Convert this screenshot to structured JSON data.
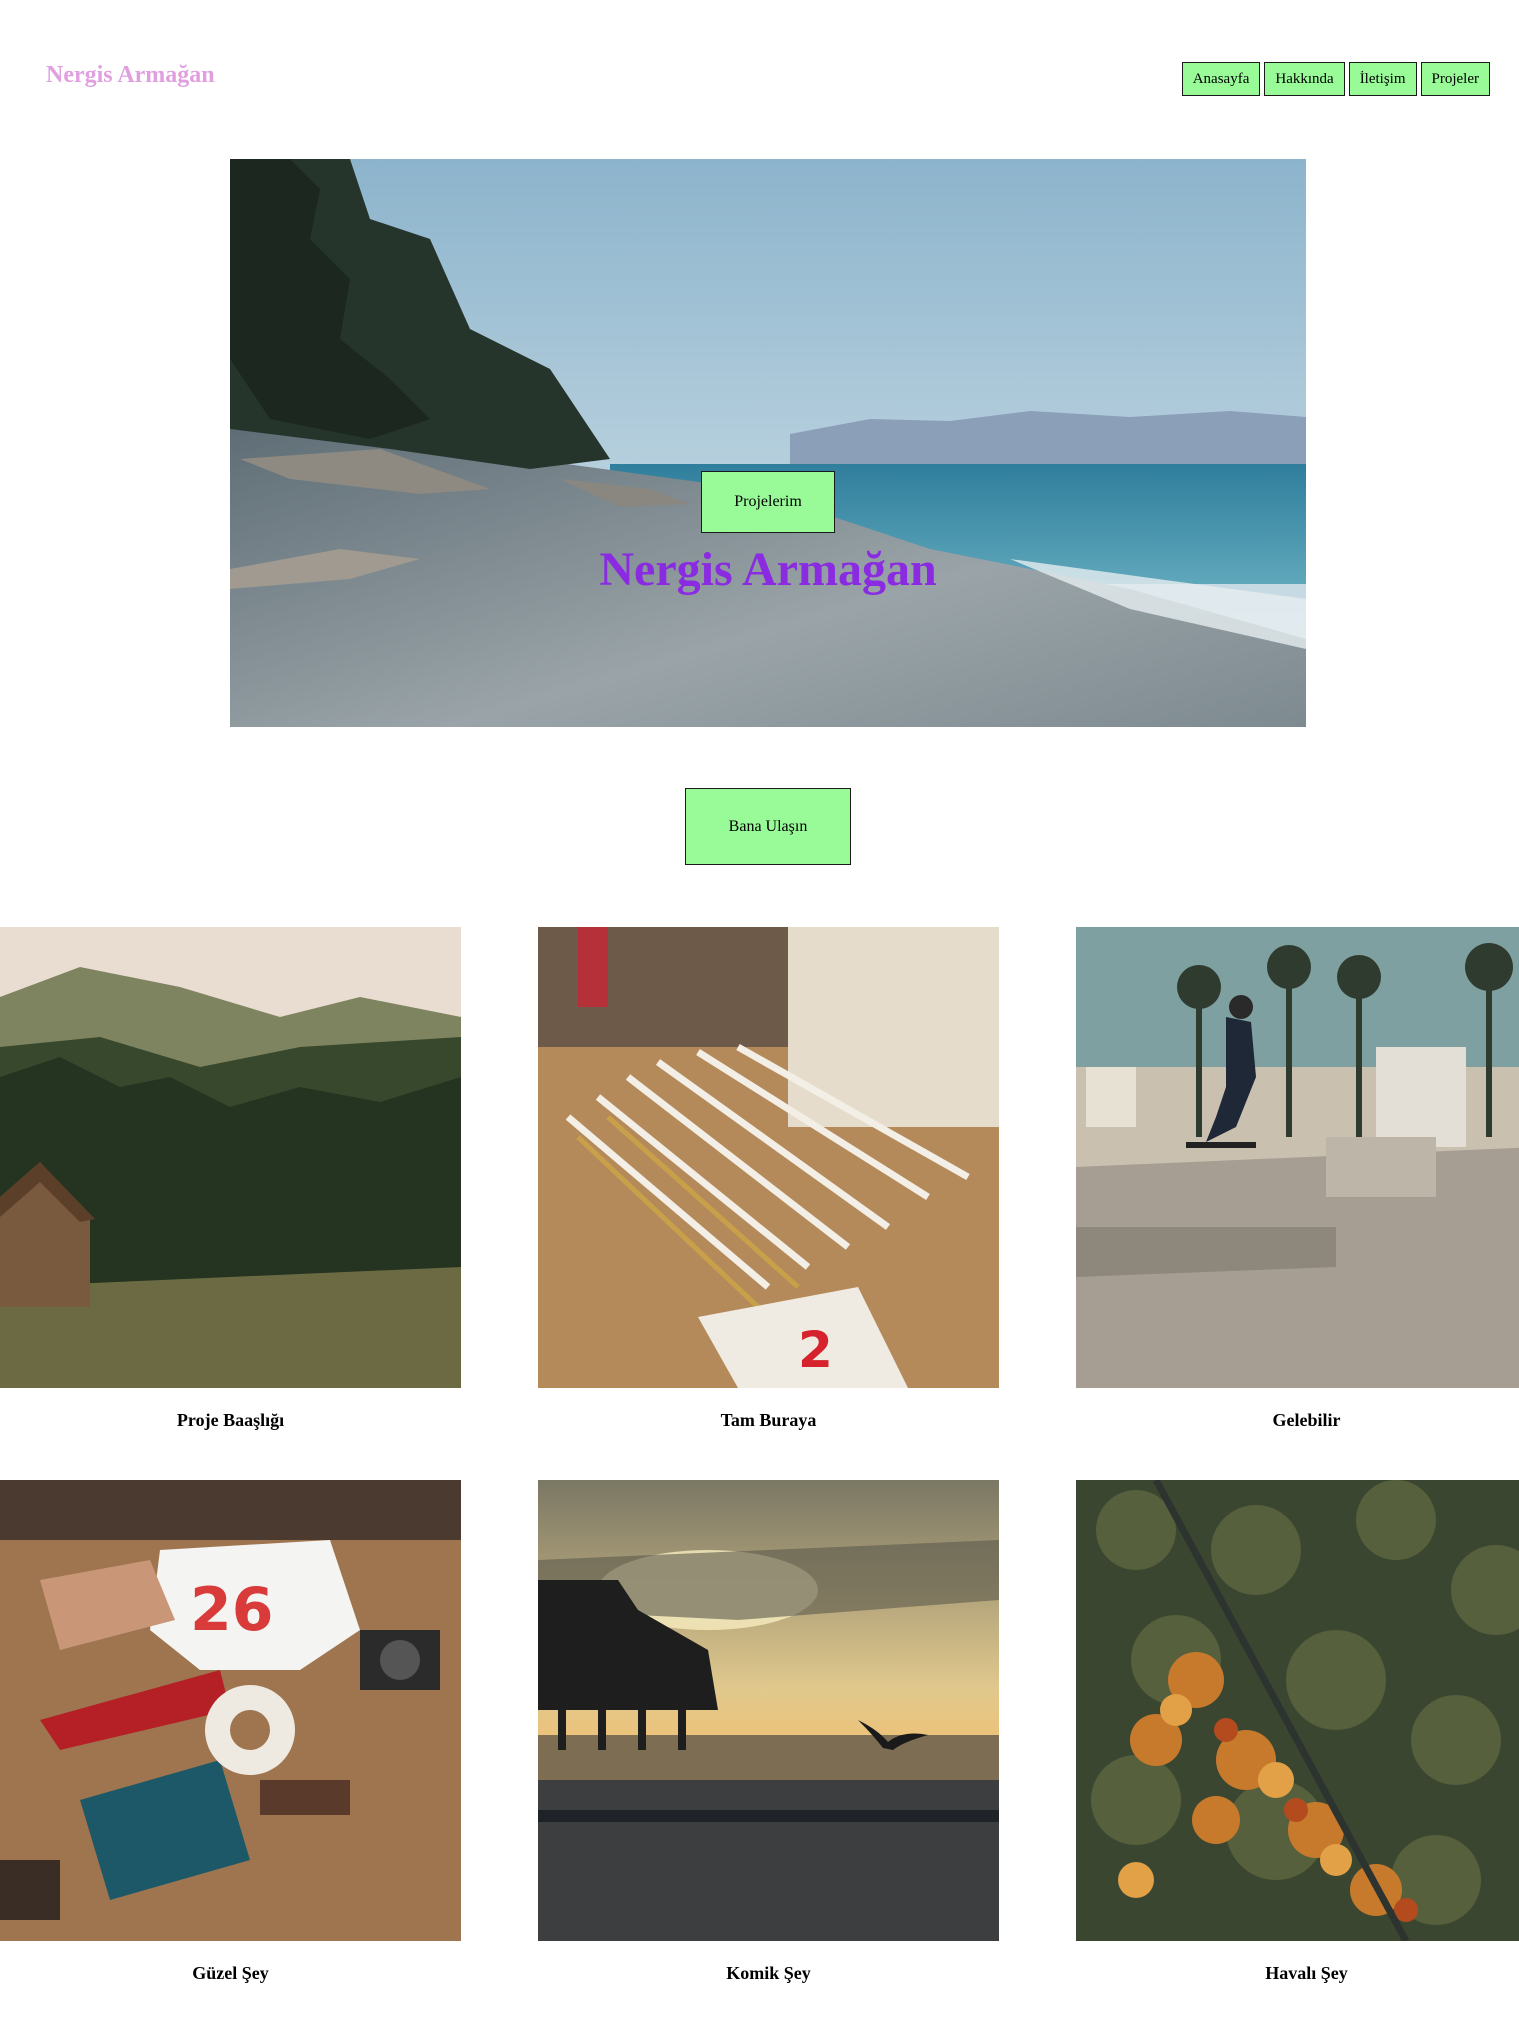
{
  "header": {
    "logo": "Nergis Armağan",
    "nav": [
      "Anasayfa",
      "Hakkında",
      "İletişim",
      "Projeler"
    ]
  },
  "hero": {
    "title": "Nergis Armağan",
    "button": "Projelerim"
  },
  "contact": {
    "button": "Bana Ulaşın"
  },
  "projects": [
    {
      "title": "Proje Baaşlığı"
    },
    {
      "title": "Tam Buraya"
    },
    {
      "title": "Gelebilir"
    },
    {
      "title": "Güzel Şey"
    },
    {
      "title": "Komik Şey"
    },
    {
      "title": "Havalı Şey"
    }
  ],
  "colors": {
    "logo": "#e0a0e0",
    "hero_title": "#8a2be2",
    "button_bg": "#98fb98"
  }
}
